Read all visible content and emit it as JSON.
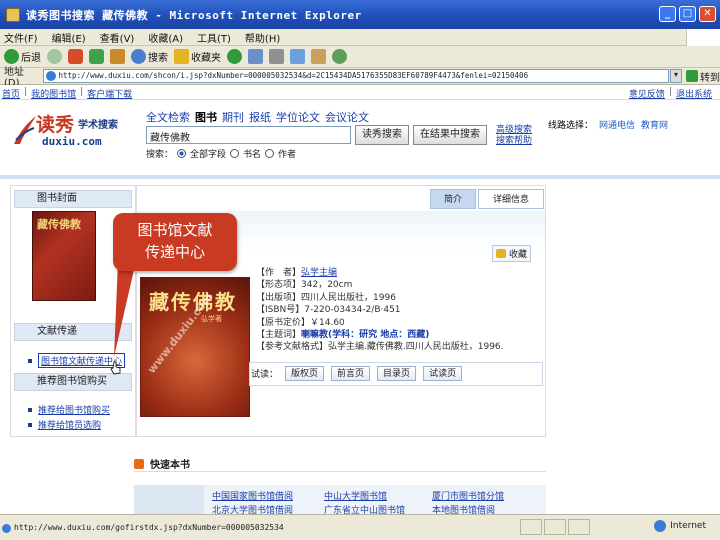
{
  "window": {
    "title": "读秀图书搜索 藏传佛教 - Microsoft Internet Explorer",
    "minimize": "_",
    "maximize": "□",
    "close": "✕"
  },
  "menubar": [
    "文件(F)",
    "编辑(E)",
    "查看(V)",
    "收藏(A)",
    "工具(T)",
    "帮助(H)"
  ],
  "toolbar": {
    "back": "后退",
    "search": "搜索",
    "favorites": "收藏夹"
  },
  "address": {
    "label": "地址(D)",
    "url": "http://www.duxiu.com/shcon/i.jsp?dxNumber=000005032534&d=2C15434DA5176355D83EF60789F4473&fenlei=02150406",
    "go": "转到"
  },
  "topnav": {
    "left": [
      "首页",
      "我的图书馆",
      "客户端下载"
    ],
    "right": [
      "意见反馈",
      "退出系统"
    ]
  },
  "logo": {
    "brand": "读秀",
    "sub": "学术搜索",
    "domain": "duxiu.com"
  },
  "search": {
    "tabs": [
      "全文检索",
      "图书",
      "期刊",
      "报纸",
      "学位论文",
      "会议论文"
    ],
    "active_tab_index": 1,
    "query": "藏传佛教",
    "button": "读秀搜索",
    "button2": "在结果中搜索",
    "adv1": "高级搜索",
    "adv2": "搜索帮助",
    "scope_label": "搜索：",
    "scope_all": "全部字段",
    "scope_title": "书名",
    "scope_author": "作者",
    "scope_selected": "all"
  },
  "route": {
    "label": "线路选择：",
    "options": [
      "网通电信",
      "教育网"
    ]
  },
  "left_panel": {
    "cover_head": "图书封面",
    "cover_text": "藏传佛教",
    "delivery_head": "文献传递",
    "delivery_link": "图书馆文献传递中心",
    "recommend_head": "推荐图书馆购买",
    "recommend_items": [
      "推荐给图书馆购买",
      "推荐给馆员选购"
    ]
  },
  "tabs": {
    "detail": "详细信息",
    "simple": "简介"
  },
  "favorite_label": "收藏",
  "book": {
    "cover_title": "藏传佛教",
    "cover_author": "弘学著",
    "watermark": "www.duxiu.com",
    "fields": [
      {
        "label": "【作　者】",
        "value": "弘学主编",
        "style": "link"
      },
      {
        "label": "【形态项】",
        "value": "342，20cm",
        "style": ""
      },
      {
        "label": "【出版项】",
        "value": "四川人民出版社，1996",
        "style": ""
      },
      {
        "label": "【ISBN号】",
        "value": "7-220-03434-2/B·451",
        "style": ""
      },
      {
        "label": "【原书定价】",
        "value": "￥14.60",
        "style": ""
      },
      {
        "label": "【主题词】",
        "value": "喇嘛教(学科：研究 地点：西藏)",
        "style": "b"
      },
      {
        "label": "【参考文献格式】",
        "value": "弘学主编.藏传佛教.四川人民出版社，1996.",
        "style": ""
      }
    ]
  },
  "read": {
    "label": "试读：",
    "buttons": [
      "版权页",
      "前言页",
      "目录页",
      "试读页"
    ]
  },
  "callout": {
    "line1": "图书馆文献",
    "line2": "传递中心"
  },
  "fast": {
    "title": "快速本书",
    "cells": [
      "中国国家图书馆借阅",
      "中山大学图书馆",
      "厦门市图书馆分馆",
      "北京大学图书馆借阅",
      "广东省立中山图书馆",
      "本地图书馆借阅"
    ]
  },
  "statusbar": {
    "url": "http://www.duxiu.com/gofirstdx.jsp?dxNumber=000005032534",
    "zone": "Internet"
  }
}
